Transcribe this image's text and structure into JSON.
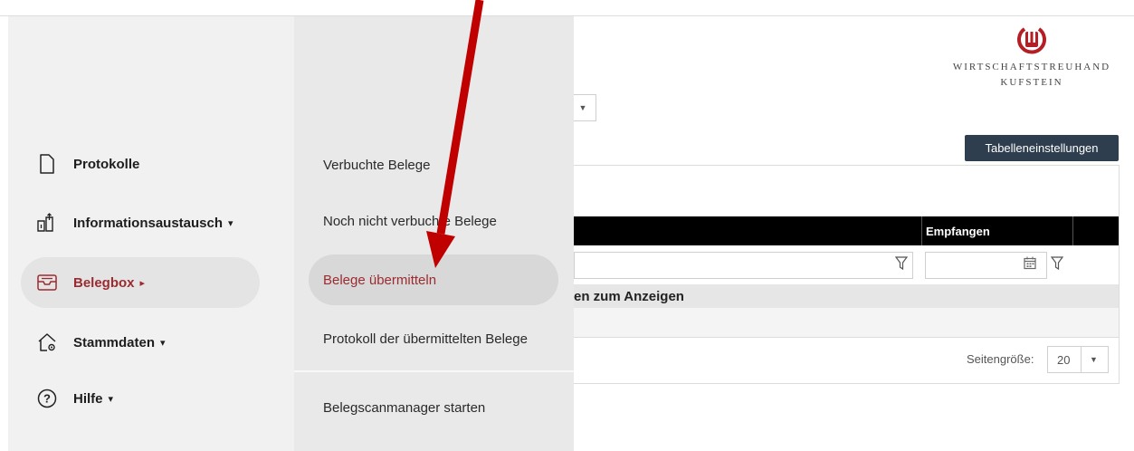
{
  "sidebar": {
    "items": [
      {
        "label": "Protokolle",
        "icon": "document-icon",
        "caret": ""
      },
      {
        "label": "Informationsaustausch",
        "icon": "exchange-icon",
        "caret": "▾"
      },
      {
        "label": "Belegbox",
        "icon": "inbox-icon",
        "caret": "▸",
        "active": true
      },
      {
        "label": "Stammdaten",
        "icon": "home-settings-icon",
        "caret": "▾"
      },
      {
        "label": "Hilfe",
        "icon": "help-icon",
        "caret": "▾"
      }
    ]
  },
  "submenu": {
    "items": [
      {
        "label": "Verbuchte Belege"
      },
      {
        "label": "Noch nicht verbuchte Belege"
      },
      {
        "label": "Belege übermitteln",
        "active": true
      },
      {
        "label": "Protokoll der übermittelten Belege"
      },
      {
        "label": "Belegscanmanager starten"
      }
    ]
  },
  "logo": {
    "line1": "WIRTSCHAFTSTREUHAND",
    "line2": "KUFSTEIN"
  },
  "main": {
    "table_settings_button": "Tabelleneinstellungen",
    "column_empfangen": "Empfangen",
    "nodata_text": "en zum Anzeigen",
    "pager_label": "Seitengröße:",
    "page_size": "20"
  },
  "colors": {
    "accent": "#9b2b30",
    "arrow": "#c00000",
    "button": "#2e3e4e"
  }
}
